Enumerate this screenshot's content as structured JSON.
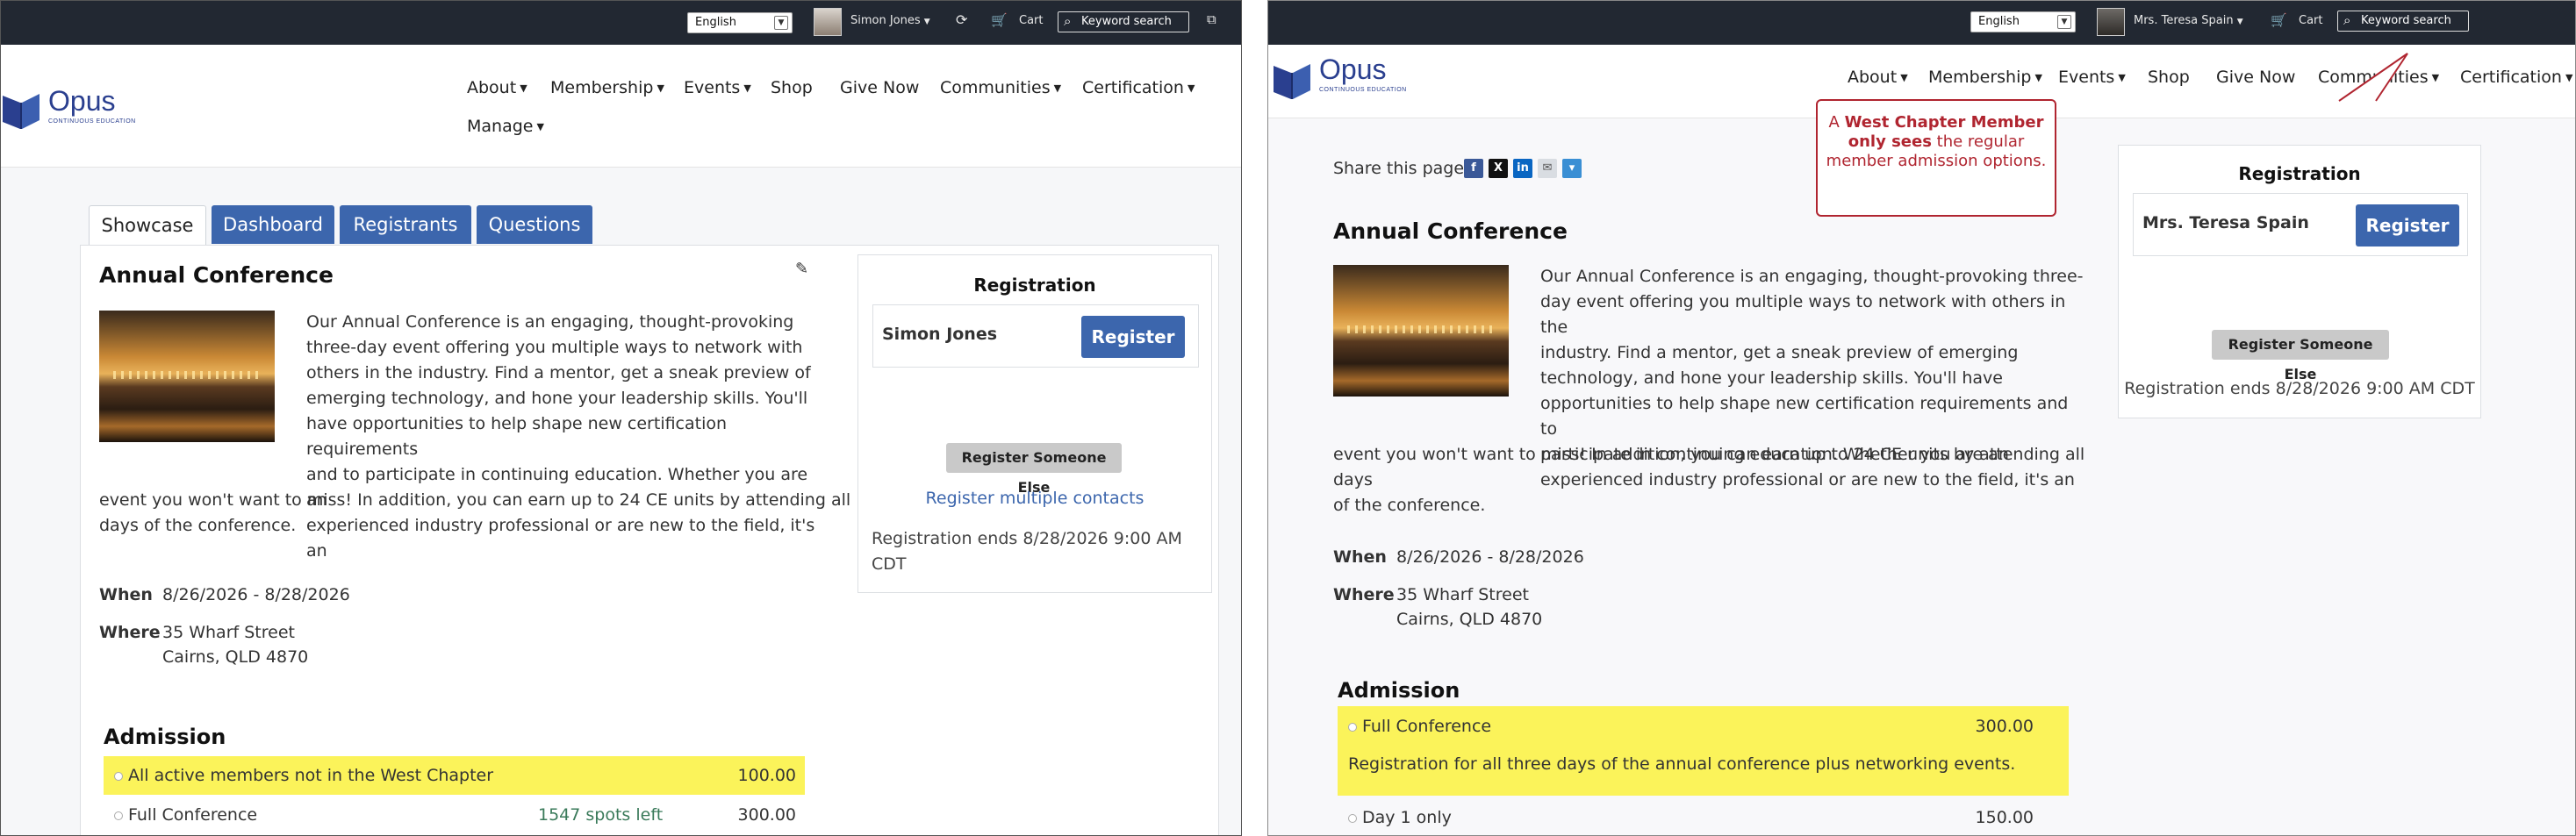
{
  "left": {
    "topbar": {
      "language": "English",
      "user_name": "Simon Jones",
      "cart": "Cart",
      "search_label": "Keyword search"
    },
    "brand": {
      "name": "Opus",
      "tagline": "CONTINUOUS   EDUCATION"
    },
    "nav": [
      "About",
      "Membership",
      "Events",
      "Shop",
      "Give Now",
      "Communities",
      "Certification",
      "Manage"
    ],
    "tabs": [
      "Showcase",
      "Dashboard",
      "Registrants",
      "Questions"
    ],
    "event": {
      "title": "Annual Conference",
      "description_lines": [
        "Our Annual Conference is an engaging, thought-provoking",
        "three-day event offering you multiple ways to network with",
        "others in the industry. Find a mentor, get a sneak preview of",
        "emerging technology, and hone your leadership skills. You'll",
        "have opportunities to help shape new certification requirements",
        "and to participate in continuing education. Whether you are an",
        "experienced industry professional or are new to the field, it's an",
        "event you won't want to miss! In addition, you can earn up to 24 CE units by attending all",
        "days of the conference."
      ],
      "when_label": "When",
      "when": "8/26/2026 - 8/28/2026",
      "where_label": "Where",
      "where_line1": "35 Wharf Street",
      "where_line2": "Cairns, QLD 4870"
    },
    "registration": {
      "title": "Registration",
      "registrant": "Simon Jones",
      "register_button": "Register",
      "register_else": "Register Someone Else",
      "register_multiple": "Register multiple contacts",
      "ends_line1": "Registration ends 8/28/2026 9:00 AM",
      "ends_line2": "CDT"
    },
    "admission": {
      "title": "Admission",
      "options": [
        {
          "name": "All active members not in the West Chapter",
          "spots": "",
          "price": "100.00",
          "highlight": true
        },
        {
          "name": "Full Conference",
          "spots": "1547 spots left",
          "price": "300.00",
          "highlight": false
        }
      ]
    }
  },
  "right": {
    "topbar": {
      "language": "English",
      "user_name": "Mrs. Teresa Spain",
      "cart": "Cart",
      "search_label": "Keyword search"
    },
    "brand": {
      "name": "Opus",
      "tagline": "CONTINUOUS   EDUCATION"
    },
    "nav": [
      "About",
      "Membership",
      "Events",
      "Shop",
      "Give Now",
      "Communities",
      "Certification"
    ],
    "share_label": "Share this page",
    "callout": {
      "prefix": "A ",
      "strong": "West Chapter Member only sees",
      "rest": " the regular member admission options."
    },
    "event": {
      "title": "Annual Conference",
      "description_lines": [
        "Our Annual Conference is an engaging, thought-provoking three-",
        "day event offering you multiple ways to network with others in the",
        "industry. Find a mentor, get a sneak preview of emerging",
        "technology, and hone your leadership skills. You'll have",
        "opportunities to help shape new certification requirements and to",
        "participate in continuing education. Whether you are an",
        "experienced industry professional or are new to the field, it's an",
        "event you won't want to miss! In addition, you can earn up to 24 CE units by attending all days",
        "of the conference."
      ],
      "when_label": "When",
      "when": "8/26/2026 - 8/28/2026",
      "where_label": "Where",
      "where_line1": "35 Wharf Street",
      "where_line2": "Cairns, QLD 4870"
    },
    "registration": {
      "title": "Registration",
      "registrant": "Mrs. Teresa Spain",
      "register_button": "Register",
      "register_else": "Register Someone Else",
      "ends": "Registration ends 8/28/2026 9:00 AM CDT"
    },
    "admission": {
      "title": "Admission",
      "options": [
        {
          "name": "Full Conference",
          "price": "300.00",
          "description": "Registration for all three days of the annual conference plus networking events."
        },
        {
          "name": "Day 1 only",
          "price": "150.00"
        }
      ]
    }
  },
  "colors": {
    "topbar": "#222832",
    "accent_blue": "#3c66ad",
    "highlight_yellow": "#fbf35a",
    "callout_red": "#b02530",
    "spots_green": "#3a7a5a"
  },
  "icons": [
    "chevron-down-icon",
    "support-icon",
    "cart-icon",
    "search-icon",
    "external-link-icon",
    "edit-pencil-icon",
    "facebook-icon",
    "x-icon",
    "linkedin-icon",
    "email-icon",
    "share-more-icon"
  ]
}
